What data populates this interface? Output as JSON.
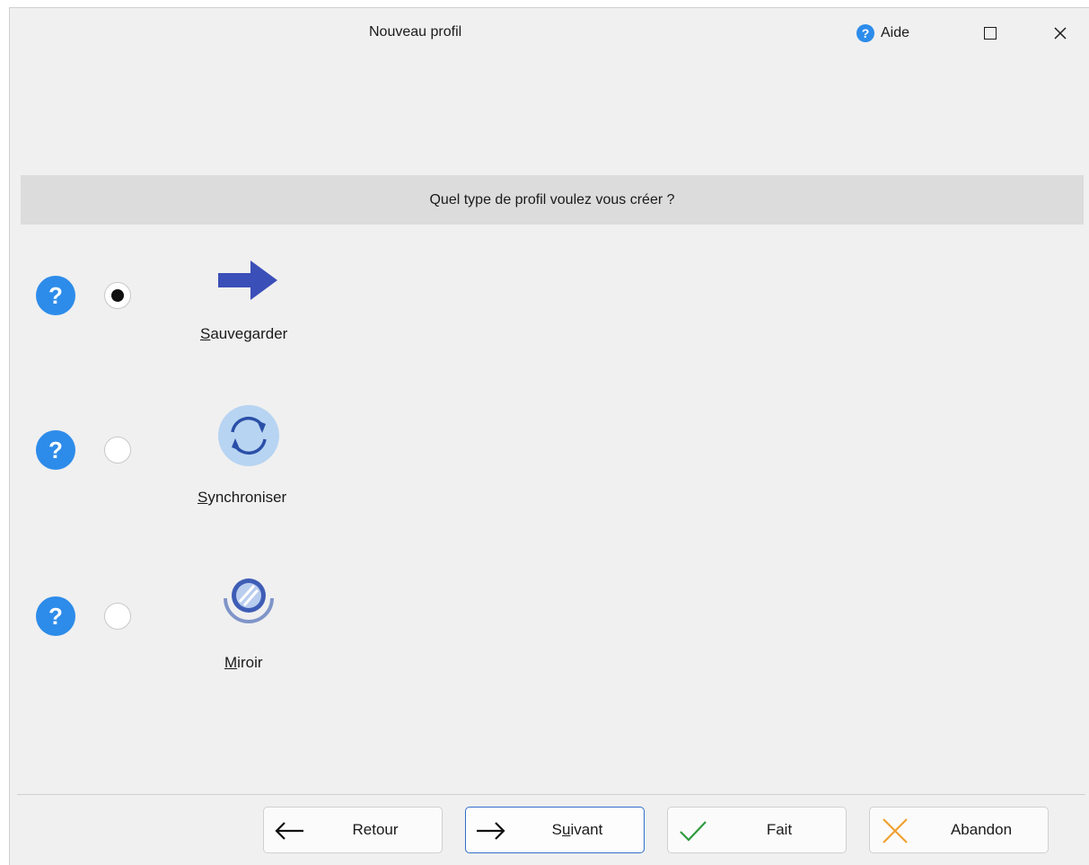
{
  "window": {
    "title": "Nouveau profil",
    "help_label": "Aide"
  },
  "question": "Quel type de profil voulez vous créer ?",
  "options": [
    {
      "label_first": "S",
      "label_rest": "auvegarder",
      "selected": true,
      "icon": "arrow-right-icon"
    },
    {
      "label_first": "S",
      "label_rest": "ynchroniser",
      "selected": false,
      "icon": "sync-icon"
    },
    {
      "label_first": "M",
      "label_rest": "iroir",
      "selected": false,
      "icon": "mirror-icon"
    }
  ],
  "buttons": {
    "back": {
      "label": "Retour",
      "icon": "arrow-left-icon"
    },
    "next": {
      "label_before": "S",
      "label_underlined": "u",
      "label_after": "ivant",
      "icon": "arrow-right-icon"
    },
    "done": {
      "label": "Fait",
      "icon": "checkmark-icon"
    },
    "cancel": {
      "label": "Abandon",
      "icon": "cross-icon"
    }
  },
  "help_glyph": "?",
  "colors": {
    "accent_blue": "#2d8cea",
    "arrow_blue": "#3b4fb8",
    "check_green": "#2e9b3e",
    "cancel_orange": "#f0a030",
    "banner_gray": "#dcdcdc"
  }
}
